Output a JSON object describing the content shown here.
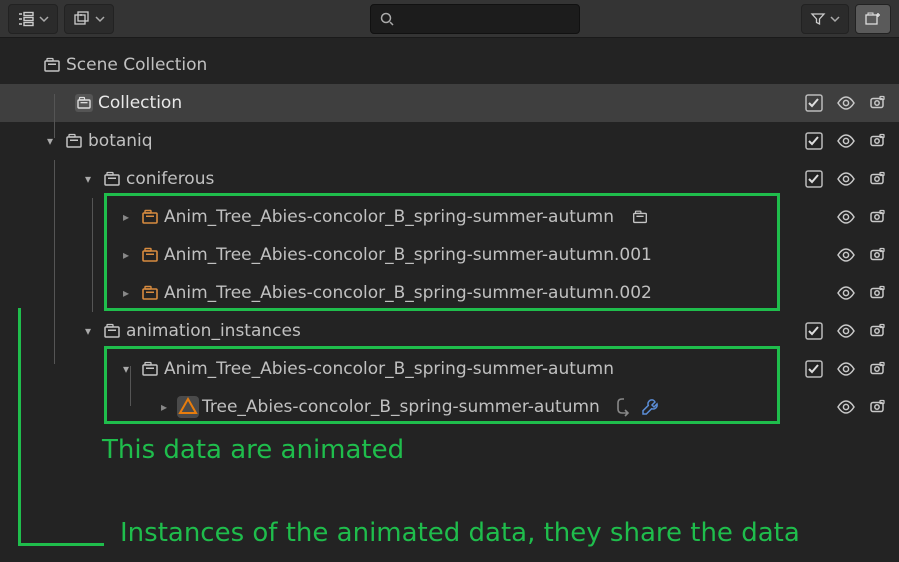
{
  "toolbar": {
    "search_placeholder": ""
  },
  "tree": {
    "root": {
      "label": "Scene Collection"
    },
    "coll": {
      "label": "Collection"
    },
    "bot": {
      "label": "botaniq"
    },
    "conif": {
      "label": "coniferous"
    },
    "a1": {
      "label": "Anim_Tree_Abies-concolor_B_spring-summer-autumn"
    },
    "a2": {
      "label": "Anim_Tree_Abies-concolor_B_spring-summer-autumn.001"
    },
    "a3": {
      "label": "Anim_Tree_Abies-concolor_B_spring-summer-autumn.002"
    },
    "anim": {
      "label": "animation_instances"
    },
    "a4": {
      "label": "Anim_Tree_Abies-concolor_B_spring-summer-autumn"
    },
    "mesh": {
      "label": "Tree_Abies-concolor_B_spring-summer-autumn"
    }
  },
  "annotations": {
    "line1": "This data are animated",
    "line2": "Instances of the animated data, they share the data"
  },
  "colors": {
    "highlight": "#1fbd4c",
    "box_orange": "#d88b3f",
    "mesh_triangle": "#e87d0d"
  }
}
